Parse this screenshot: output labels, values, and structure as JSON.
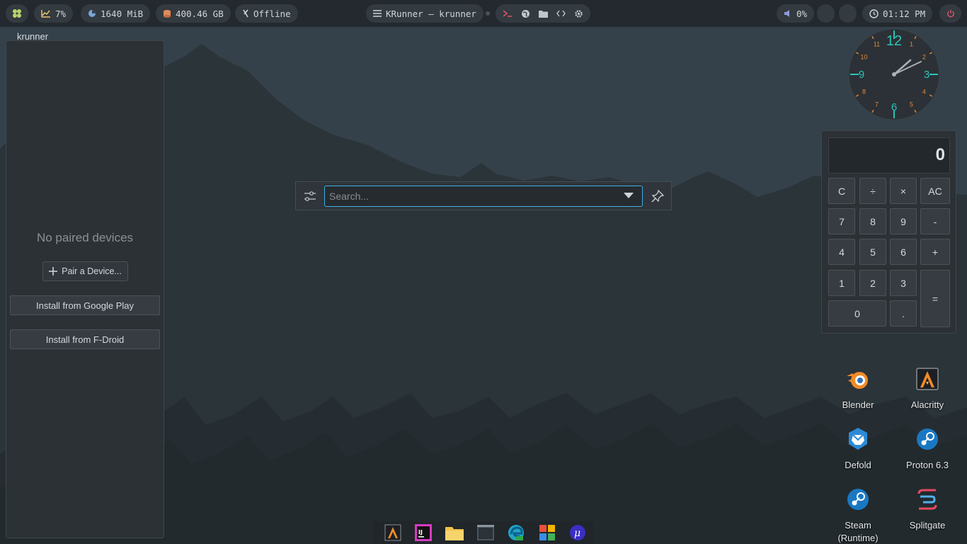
{
  "topbar": {
    "cpu": "7%",
    "memory": "1640 MiB",
    "disk": "400.46 GB",
    "network": "Offline",
    "window_title": "KRunner — krunner",
    "volume": "0%",
    "time": "01:12 PM"
  },
  "kdeconnect": {
    "window_label": "krunner",
    "empty_message": "No paired devices",
    "pair_button": "Pair a Device...",
    "install_google": "Install from Google Play",
    "install_fdroid": "Install from F-Droid"
  },
  "krunner": {
    "search_placeholder": "Search...",
    "search_value": ""
  },
  "clock": {
    "numbers": [
      "12",
      "1",
      "2",
      "3",
      "4",
      "5",
      "6",
      "7",
      "8",
      "9",
      "10",
      "11"
    ],
    "time": "01:12"
  },
  "calculator": {
    "display": "0",
    "keys": {
      "clear": "C",
      "divide": "÷",
      "multiply": "×",
      "all_clear": "AC",
      "seven": "7",
      "eight": "8",
      "nine": "9",
      "minus": "-",
      "four": "4",
      "five": "5",
      "six": "6",
      "plus": "+",
      "one": "1",
      "two": "2",
      "three": "3",
      "equals": "=",
      "zero": "0",
      "decimal": "."
    }
  },
  "desktop_icons": [
    {
      "label": "Blender",
      "icon": "blender-icon"
    },
    {
      "label": "Alacritty",
      "icon": "alacritty-icon"
    },
    {
      "label": "Defold",
      "icon": "defold-icon"
    },
    {
      "label": "Proton 6.3",
      "icon": "steam-icon"
    },
    {
      "label": "Steam\n(Runtime)",
      "icon": "steam-icon"
    },
    {
      "label": "Splitgate",
      "icon": "splitgate-icon"
    }
  ],
  "dock_apps": [
    "alacritty-icon",
    "intellij-icon",
    "folder-icon",
    "terminal-icon",
    "edge-dev-icon",
    "store-icon",
    "mu-icon"
  ],
  "colors": {
    "accent": "#3daee9",
    "panel_bg": "#2c3136",
    "topbar_bg": "#23292e",
    "clock_accent": "#2ec4b6",
    "clock_orange": "#e5883a"
  }
}
